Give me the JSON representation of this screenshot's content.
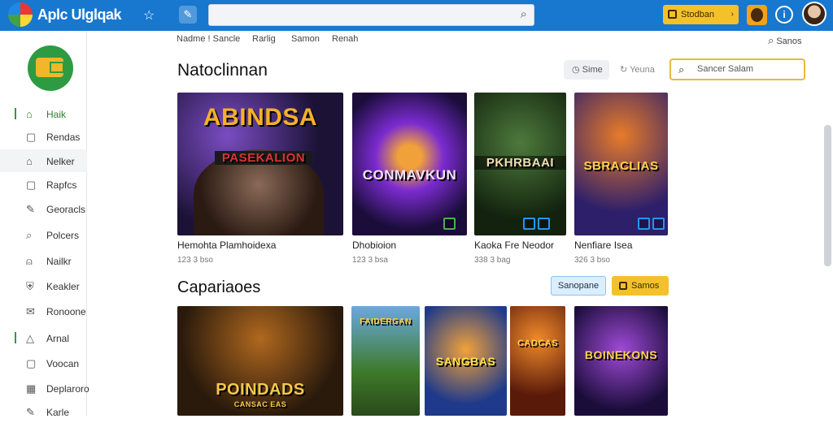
{
  "app": {
    "title": "Aplc Ulglqak"
  },
  "topbar": {
    "search_icon": "search-icon",
    "account_button_label": "Stodban",
    "info_label": "i"
  },
  "sidebar": {
    "items": [
      {
        "label": "Haik",
        "icon": "home-icon"
      },
      {
        "label": "Rendas",
        "icon": "square-icon"
      },
      {
        "label": "Nelker",
        "icon": "building-icon"
      },
      {
        "label": "Rapfcs",
        "icon": "square-icon"
      },
      {
        "label": "Georacls",
        "icon": "pen-icon"
      },
      {
        "label": "Polcers",
        "icon": "search-icon"
      },
      {
        "label": "Nailkr",
        "icon": "bell-icon"
      },
      {
        "label": "Keakler",
        "icon": "shield-icon"
      },
      {
        "label": "Ronoone",
        "icon": "mail-icon"
      },
      {
        "label": "Arnal",
        "icon": "triangle-icon"
      },
      {
        "label": "Voocan",
        "icon": "square-icon"
      },
      {
        "label": "Deplaroro",
        "icon": "grid-icon"
      },
      {
        "label": "Karle",
        "icon": "pen-icon"
      }
    ]
  },
  "subnav": {
    "items": [
      "Nadme ! Sancle",
      "Rarlig",
      "Samon",
      "Renah"
    ],
    "search_label": "Sanos"
  },
  "section1": {
    "title": "Natoclinnan",
    "pill1": "Sime",
    "pill2": "Yeuna",
    "search_placeholder": "Sancer Salam",
    "cards": [
      {
        "art_title": "ABINDSA",
        "art_sub": "PASEKALION",
        "caption": "Hemohta Plamhoidexa",
        "meta": "123 3 bso"
      },
      {
        "art_title": "CONMAVKUN",
        "art_sub": "",
        "caption": "Dhobioion",
        "meta": "123 3 bsa"
      },
      {
        "art_title": "PKHRBAAI",
        "art_sub": "",
        "caption": "Kaoka Fre Neodor",
        "meta": "338 3 bag"
      },
      {
        "art_title": "SBRACLIAS",
        "art_sub": "",
        "caption": "Nenfiare Isea",
        "meta": "326 3 bso"
      }
    ]
  },
  "section2": {
    "title": "Capariaoes",
    "btn_blue": "Sanopane",
    "btn_yellow": "Samos",
    "cards": [
      {
        "art_title": "POINDADS",
        "art_sub": "CANSAC EAS"
      },
      {
        "art_title": "FAIDERGAN",
        "art_sub": ""
      },
      {
        "art_title": "SANGBAS",
        "art_sub": ""
      },
      {
        "art_title": "CADCAS",
        "art_sub": ""
      },
      {
        "art_title": "BOINEKONS",
        "art_sub": ""
      }
    ]
  },
  "colors": {
    "topbar": "#1877cf",
    "accent_green": "#2e9b43",
    "accent_yellow": "#f4c12a"
  }
}
